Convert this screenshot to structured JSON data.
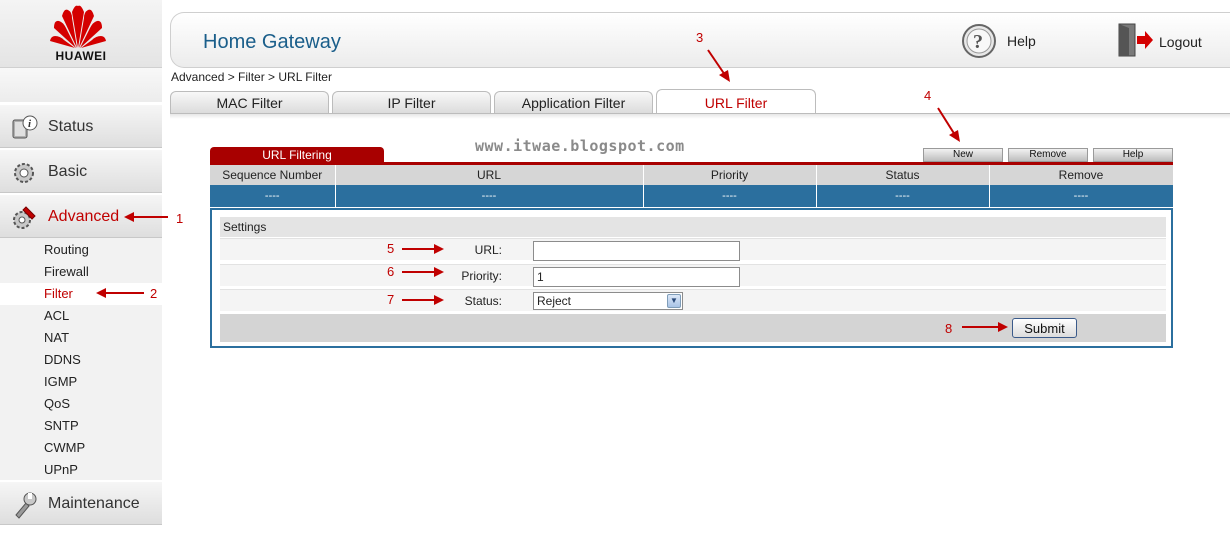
{
  "brand": {
    "name": "HUAWEI",
    "color": "#c00000"
  },
  "sidebar": {
    "menu": [
      {
        "label": "Status",
        "icon": "status-icon"
      },
      {
        "label": "Basic",
        "icon": "basic-icon"
      },
      {
        "label": "Advanced",
        "icon": "advanced-icon",
        "active": true
      },
      {
        "label": "Maintenance",
        "icon": "maintenance-icon"
      }
    ],
    "advanced_items": [
      "Routing",
      "Firewall",
      "Filter",
      "ACL",
      "NAT",
      "DDNS",
      "IGMP",
      "QoS",
      "SNTP",
      "CWMP",
      "UPnP"
    ],
    "active_item": "Filter"
  },
  "header": {
    "title": "Home Gateway",
    "help_label": "Help",
    "logout_label": "Logout"
  },
  "breadcrumb": "Advanced > Filter > URL Filter",
  "tabs": [
    {
      "label": "MAC Filter"
    },
    {
      "label": "IP Filter"
    },
    {
      "label": "Application Filter"
    },
    {
      "label": "URL Filter",
      "active": true
    }
  ],
  "watermark": "www.itwae.blogspot.com",
  "table": {
    "caption": "URL Filtering",
    "buttons": {
      "new": "New",
      "remove": "Remove",
      "help": "Help"
    },
    "columns": [
      "Sequence Number",
      "URL",
      "Priority",
      "Status",
      "Remove"
    ],
    "rows": [
      [
        "----",
        "----",
        "----",
        "----",
        "----"
      ]
    ]
  },
  "settings": {
    "title": "Settings",
    "url_label": "URL:",
    "url_value": "",
    "priority_label": "Priority:",
    "priority_value": "1",
    "status_label": "Status:",
    "status_value": "Reject",
    "submit_label": "Submit"
  },
  "annotations": [
    "1",
    "2",
    "3",
    "4",
    "5",
    "6",
    "7",
    "8"
  ],
  "colors": {
    "accent": "#c00000",
    "table_row": "#2b6f9e",
    "title": "#1a5e8a"
  }
}
